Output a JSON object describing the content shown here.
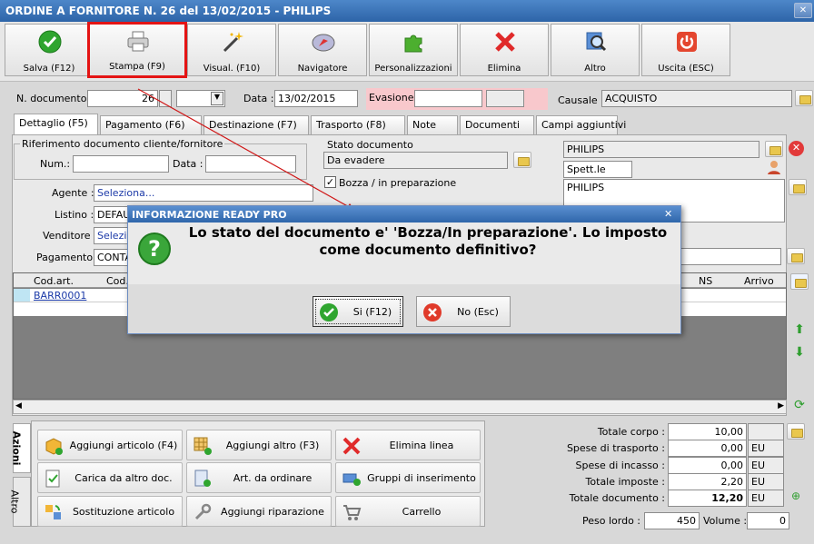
{
  "window": {
    "title": "ORDINE A FORNITORE N. 26 del 13/02/2015 - PHILIPS"
  },
  "toolbar": {
    "buttons": [
      {
        "label": "Salva (F12)",
        "icon": "check-icon"
      },
      {
        "label": "Stampa (F9)",
        "icon": "printer-icon"
      },
      {
        "label": "Visual. (F10)",
        "icon": "magic-wand-icon"
      },
      {
        "label": "Navigatore",
        "icon": "compass-icon"
      },
      {
        "label": "Personalizzazioni",
        "icon": "puzzle-icon"
      },
      {
        "label": "Elimina",
        "icon": "cross-icon"
      },
      {
        "label": "Altro",
        "icon": "magnifier-icon"
      },
      {
        "label": "Uscita (ESC)",
        "icon": "power-icon"
      }
    ]
  },
  "header": {
    "ndoc_label": "N. documento :",
    "ndoc_value": "26",
    "data_label": "Data :",
    "data_value": "13/02/2015",
    "evasione_label": "Evasione:",
    "causale_label": "Causale :",
    "causale_value": "ACQUISTO"
  },
  "tabs": [
    "Dettaglio (F5)",
    "Pagamento (F6)",
    "Destinazione (F7)",
    "Trasporto (F8)",
    "Note",
    "Documenti",
    "Campi aggiuntivi"
  ],
  "riferimento": {
    "legend": "Riferimento documento cliente/fornitore",
    "num_label": "Num.:",
    "data_label": "Data :"
  },
  "stato": {
    "legend": "Stato documento",
    "value": "Da evadere",
    "bozza_label": "Bozza / in preparazione"
  },
  "fields": {
    "agente_label": "Agente :",
    "agente_value": "Seleziona...",
    "listino_label": "Listino :",
    "listino_value": "DEFAU",
    "venditore_label": "Venditore :",
    "venditore_value": "Selezio",
    "pagamento_label": "Pagamento :",
    "pagamento_value": "CONTA"
  },
  "supplier": {
    "name": "PHILIPS",
    "salutation": "Spett.le",
    "address_line1": "PHILIPS"
  },
  "grid": {
    "headers": {
      "codart": "Cod.art.",
      "cod": "Cod.",
      "ns": "NS",
      "arrivo": "Arrivo"
    },
    "rows": [
      {
        "codart": "BARR0001"
      }
    ]
  },
  "dialog": {
    "title": "INFORMAZIONE READY PRO",
    "message": "Lo stato del documento e' 'Bozza/In preparazione'. Lo imposto come documento definitivo?",
    "yes_label": "Si (F12)",
    "no_label": "No (Esc)"
  },
  "actions": {
    "side_tabs": [
      "Azioni",
      "Altro"
    ],
    "buttons": [
      {
        "label": "Aggiungi articolo (F4)",
        "icon": "box-add-icon"
      },
      {
        "label": "Aggiungi altro (F3)",
        "icon": "grid-add-icon"
      },
      {
        "label": "Elimina linea",
        "icon": "cross-icon"
      },
      {
        "label": "Carica da altro doc.",
        "icon": "document-check-icon"
      },
      {
        "label": "Art. da ordinare",
        "icon": "document-add-icon"
      },
      {
        "label": "Gruppi di inserimento",
        "icon": "group-add-icon"
      },
      {
        "label": "Sostituzione articolo",
        "icon": "swap-icon"
      },
      {
        "label": "Aggiungi riparazione",
        "icon": "wrench-icon"
      },
      {
        "label": "Carrello",
        "icon": "cart-icon"
      }
    ]
  },
  "totals": {
    "totale_corpo_label": "Totale corpo :",
    "totale_corpo": "10,00",
    "spese_trasporto_label": "Spese di trasporto :",
    "spese_trasporto": "0,00",
    "spese_incasso_label": "Spese di incasso :",
    "spese_incasso": "0,00",
    "totale_imposte_label": "Totale imposte :",
    "totale_imposte": "2,20",
    "totale_documento_label": "Totale documento :",
    "totale_documento": "12,20",
    "currency": "EU",
    "peso_label": "Peso lordo :",
    "peso": "450",
    "volume_label": "Volume :",
    "volume": "0"
  },
  "colors": {
    "titlebar": "#2d64a8",
    "highlight": "#e41414",
    "evasione_bg": "#f8c8cc"
  }
}
